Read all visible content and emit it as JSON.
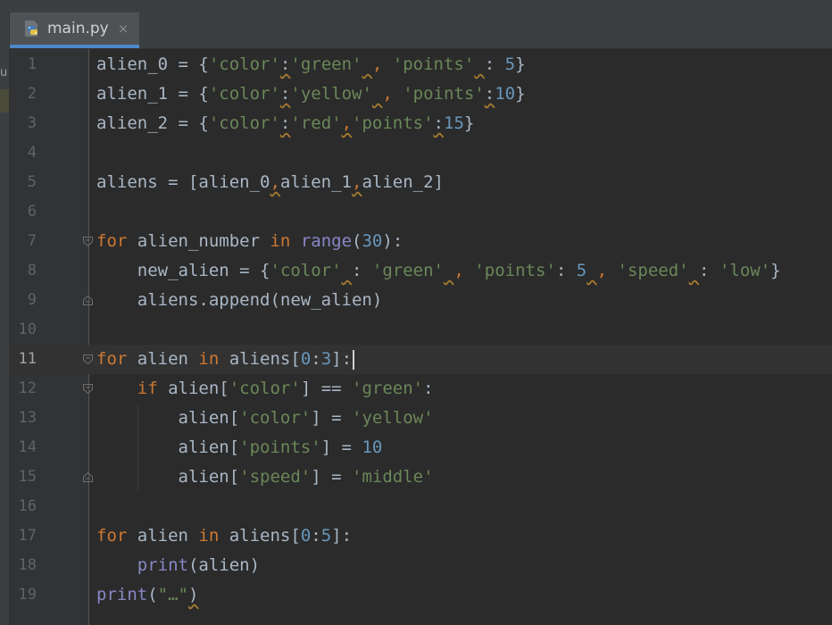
{
  "tab": {
    "filename": "main.py",
    "close_glyph": "×",
    "icon": "python-file-icon"
  },
  "left_strip_text": "u",
  "current_line": 11,
  "line_numbers": [
    "1",
    "2",
    "3",
    "4",
    "5",
    "6",
    "7",
    "8",
    "9",
    "10",
    "11",
    "12",
    "13",
    "14",
    "15",
    "16",
    "17",
    "18",
    "19"
  ],
  "code_lines": [
    [
      {
        "t": "alien_0 = {",
        "c": "tx"
      },
      {
        "t": "'color'",
        "c": "st"
      },
      {
        "t": ":",
        "c": "tx",
        "w": true
      },
      {
        "t": "'green'",
        "c": "st"
      },
      {
        "t": " ",
        "c": "tx",
        "w": true
      },
      {
        "t": ", ",
        "c": "kw"
      },
      {
        "t": "'points'",
        "c": "st"
      },
      {
        "t": " ",
        "c": "tx",
        "w": true
      },
      {
        "t": ": ",
        "c": "tx"
      },
      {
        "t": "5",
        "c": "nm"
      },
      {
        "t": "}",
        "c": "tx"
      }
    ],
    [
      {
        "t": "alien_1 = {",
        "c": "tx"
      },
      {
        "t": "'color'",
        "c": "st"
      },
      {
        "t": ":",
        "c": "tx",
        "w": true
      },
      {
        "t": "'yellow'",
        "c": "st"
      },
      {
        "t": " ",
        "c": "tx",
        "w": true
      },
      {
        "t": ", ",
        "c": "kw"
      },
      {
        "t": "'points'",
        "c": "st"
      },
      {
        "t": ":",
        "c": "tx",
        "w": true
      },
      {
        "t": "10",
        "c": "nm"
      },
      {
        "t": "}",
        "c": "tx"
      }
    ],
    [
      {
        "t": "alien_2 = {",
        "c": "tx"
      },
      {
        "t": "'color'",
        "c": "st"
      },
      {
        "t": ":",
        "c": "tx",
        "w": true
      },
      {
        "t": "'red'",
        "c": "st"
      },
      {
        "t": ",",
        "c": "kw",
        "w": true
      },
      {
        "t": "'points'",
        "c": "st"
      },
      {
        "t": ":",
        "c": "tx",
        "w": true
      },
      {
        "t": "15",
        "c": "nm"
      },
      {
        "t": "}",
        "c": "tx"
      }
    ],
    [],
    [
      {
        "t": "aliens = [alien_0",
        "c": "tx"
      },
      {
        "t": ",",
        "c": "kw",
        "w": true
      },
      {
        "t": "alien_1",
        "c": "tx"
      },
      {
        "t": ",",
        "c": "kw",
        "w": true
      },
      {
        "t": "alien_2]",
        "c": "tx"
      }
    ],
    [],
    [
      {
        "t": "for",
        "c": "kw"
      },
      {
        "t": " alien_number ",
        "c": "tx"
      },
      {
        "t": "in",
        "c": "kw"
      },
      {
        "t": " ",
        "c": "tx"
      },
      {
        "t": "range",
        "c": "bi"
      },
      {
        "t": "(",
        "c": "tx"
      },
      {
        "t": "30",
        "c": "nm"
      },
      {
        "t": "):",
        "c": "tx"
      }
    ],
    [
      {
        "t": "    new_alien = {",
        "c": "tx"
      },
      {
        "t": "'color'",
        "c": "st"
      },
      {
        "t": " ",
        "c": "tx",
        "w": true
      },
      {
        "t": ": ",
        "c": "tx"
      },
      {
        "t": "'green'",
        "c": "st"
      },
      {
        "t": " ",
        "c": "tx",
        "w": true
      },
      {
        "t": ", ",
        "c": "kw"
      },
      {
        "t": "'points'",
        "c": "st"
      },
      {
        "t": ": ",
        "c": "tx"
      },
      {
        "t": "5",
        "c": "nm"
      },
      {
        "t": " ",
        "c": "tx",
        "w": true
      },
      {
        "t": ", ",
        "c": "kw"
      },
      {
        "t": "'speed'",
        "c": "st"
      },
      {
        "t": " ",
        "c": "tx",
        "w": true
      },
      {
        "t": ": ",
        "c": "tx"
      },
      {
        "t": "'low'",
        "c": "st"
      },
      {
        "t": "}",
        "c": "tx"
      }
    ],
    [
      {
        "t": "    aliens.append(new_alien)",
        "c": "tx"
      }
    ],
    [],
    [
      {
        "t": "for",
        "c": "kw"
      },
      {
        "t": " alien ",
        "c": "tx"
      },
      {
        "t": "in",
        "c": "kw"
      },
      {
        "t": " aliens[",
        "c": "tx"
      },
      {
        "t": "0",
        "c": "nm"
      },
      {
        "t": ":",
        "c": "tx"
      },
      {
        "t": "3",
        "c": "nm"
      },
      {
        "t": "]:",
        "c": "tx"
      }
    ],
    [
      {
        "t": "    ",
        "c": "tx"
      },
      {
        "t": "if",
        "c": "kw"
      },
      {
        "t": " alien[",
        "c": "tx"
      },
      {
        "t": "'color'",
        "c": "st"
      },
      {
        "t": "] == ",
        "c": "tx"
      },
      {
        "t": "'green'",
        "c": "st"
      },
      {
        "t": ":",
        "c": "tx"
      }
    ],
    [
      {
        "t": "        alien[",
        "c": "tx"
      },
      {
        "t": "'color'",
        "c": "st"
      },
      {
        "t": "] = ",
        "c": "tx"
      },
      {
        "t": "'yellow'",
        "c": "st"
      }
    ],
    [
      {
        "t": "        alien[",
        "c": "tx"
      },
      {
        "t": "'points'",
        "c": "st"
      },
      {
        "t": "] = ",
        "c": "tx"
      },
      {
        "t": "10",
        "c": "nm"
      }
    ],
    [
      {
        "t": "        alien[",
        "c": "tx"
      },
      {
        "t": "'speed'",
        "c": "st"
      },
      {
        "t": "] = ",
        "c": "tx"
      },
      {
        "t": "'middle'",
        "c": "st"
      }
    ],
    [],
    [
      {
        "t": "for",
        "c": "kw"
      },
      {
        "t": " alien ",
        "c": "tx"
      },
      {
        "t": "in",
        "c": "kw"
      },
      {
        "t": " aliens[",
        "c": "tx"
      },
      {
        "t": "0",
        "c": "nm"
      },
      {
        "t": ":",
        "c": "tx"
      },
      {
        "t": "5",
        "c": "nm"
      },
      {
        "t": "]:",
        "c": "tx"
      }
    ],
    [
      {
        "t": "    ",
        "c": "tx"
      },
      {
        "t": "print",
        "c": "bi"
      },
      {
        "t": "(alien)",
        "c": "tx"
      }
    ],
    [
      {
        "t": "print",
        "c": "bi"
      },
      {
        "t": "(",
        "c": "tx"
      },
      {
        "t": "\"…\"",
        "c": "st"
      },
      {
        "t": ")",
        "c": "tx",
        "w": true
      }
    ]
  ],
  "fold_markers": [
    {
      "line": 7,
      "kind": "open"
    },
    {
      "line": 9,
      "kind": "end"
    },
    {
      "line": 11,
      "kind": "open"
    },
    {
      "line": 12,
      "kind": "open"
    },
    {
      "line": 15,
      "kind": "end"
    }
  ],
  "colors": {
    "background": "#2b2b2b",
    "keyword": "#cc7832",
    "string": "#6a8759",
    "number": "#6897bb",
    "builtin": "#8888c6",
    "text": "#a9b7c6",
    "tab_underline": "#4a88c7"
  }
}
